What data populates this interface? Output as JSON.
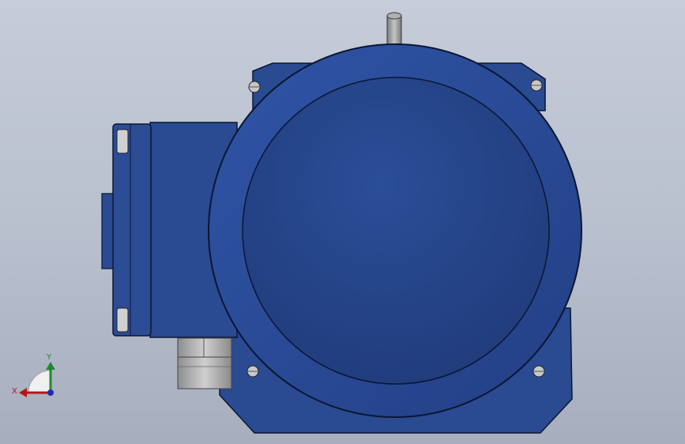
{
  "viewport": {
    "background_top": "#c6ccd8",
    "background_bottom": "#a7aebd"
  },
  "model": {
    "body_color": "#2a4a92",
    "body_dark": "#1f3a78",
    "edge_color": "#0b1633",
    "bolt_color": "#c8c8c8",
    "conduit_color": "#a8a8a8",
    "shaft_color": "#9a9a9a"
  },
  "triad": {
    "x_label": "X",
    "y_label": "Y",
    "x_color": "#b01818",
    "y_color": "#1f8a2a",
    "z_color": "#1f2ab8"
  }
}
